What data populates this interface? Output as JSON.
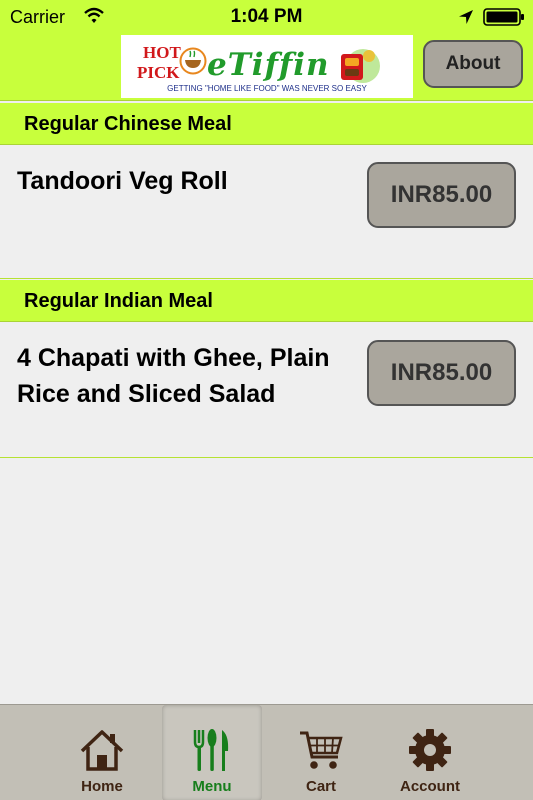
{
  "status_bar": {
    "carrier": "Carrier",
    "time": "1:04 PM"
  },
  "header": {
    "logo_hot": "HOT",
    "logo_pick": "PICK",
    "logo_brand": "eTiffin",
    "logo_tagline": "GETTING \"HOME LIKE FOOD\" WAS NEVER SO EASY",
    "about_label": "About"
  },
  "sections": [
    {
      "title": "Regular Chinese Meal",
      "items": [
        {
          "name": "Tandoori Veg Roll",
          "price": "INR85.00"
        }
      ]
    },
    {
      "title": "Regular Indian Meal",
      "items": [
        {
          "name": "4 Chapati with Ghee, Plain Rice and Sliced Salad",
          "price": "INR85.00"
        }
      ]
    }
  ],
  "tabs": [
    {
      "label": "Home",
      "icon": "home-icon",
      "selected": false
    },
    {
      "label": "Menu",
      "icon": "fork-knife-icon",
      "selected": true
    },
    {
      "label": "Cart",
      "icon": "cart-icon",
      "selected": false
    },
    {
      "label": "Account",
      "icon": "gear-icon",
      "selected": false
    }
  ],
  "colors": {
    "accent_green": "#c8ff3c",
    "tab_selected_text": "#177e1c",
    "tab_text": "#3f2413",
    "button_gray": "#aaa69d"
  }
}
